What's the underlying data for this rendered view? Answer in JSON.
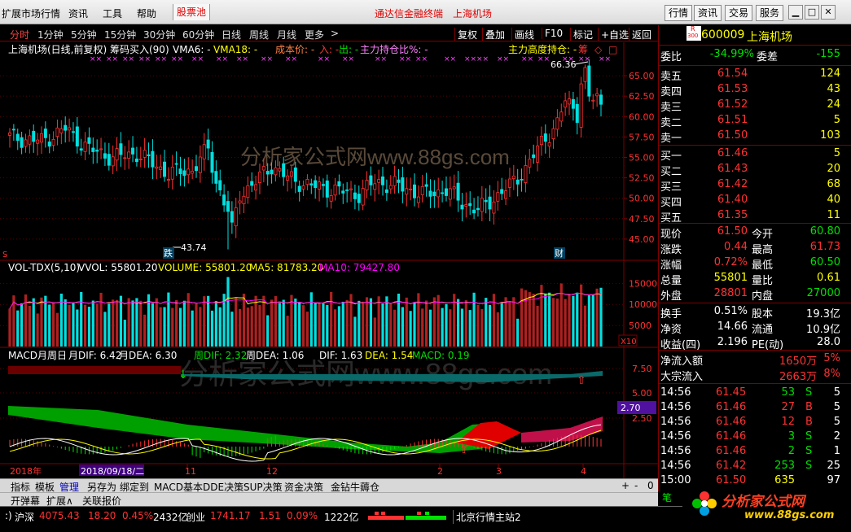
{
  "menubar": {
    "items": [
      "扩展市场行情",
      "资讯",
      "工具",
      "帮助"
    ],
    "stock_pool": "股票池",
    "center_title": "通达信金融终端",
    "center_stock": "上海机场",
    "right_buttons": [
      "行情",
      "资讯",
      "交易",
      "服务"
    ]
  },
  "periods": [
    "分时",
    "1分钟",
    "5分钟",
    "15分钟",
    "30分钟",
    "60分钟",
    "日线",
    "周线",
    "月线",
    "更多",
    ">"
  ],
  "active_period": "分时",
  "tools": [
    "复权",
    "叠加",
    "画线",
    "F10",
    "标记",
    "+自选",
    "返回"
  ],
  "main_chart": {
    "title": "上海机场(日线,前复权) 筹码买入(90)",
    "vma6": "VMA6: -",
    "vma18": "VMA18: -",
    "cost": "成本价: -",
    "in": "入: -",
    "out": "出: -",
    "holding": "主力持仓比%: -",
    "height": "主力高度持仓: -",
    "chou": "筹",
    "high_label": "66.36",
    "low_label": "43.74",
    "die_tag": "跌",
    "cai_tag": "财",
    "watermark": "分析家公式网www.88gs.com",
    "s_marker": "S",
    "y_ticks": [
      "65.00",
      "62.50",
      "60.00",
      "57.50",
      "55.00",
      "52.50",
      "50.00",
      "47.50",
      "45.00"
    ]
  },
  "volume_chart": {
    "title": "VOL-TDX(5,10)",
    "vvol": "VVOL: 55801.20",
    "volume": "VOLUME: 55801.20",
    "ma5": "MA5: 81783.20",
    "ma10": "MA10: 79427.80",
    "y_ticks": [
      "15000",
      "10000",
      "5000"
    ],
    "unit": "X10"
  },
  "macd_chart": {
    "title": "MACD月周日",
    "mdif": "月DIF: 6.42",
    "mdea": "月DEA: 6.30",
    "wdif": "周DIF: 2.32",
    "wdea": "周DEA: 1.06",
    "dif": "DIF: 1.63",
    "dea": "DEA: 1.54",
    "macd": "MACD: 0.19",
    "y_ticks": [
      "7.50",
      "5.00",
      "2.50"
    ],
    "badge": "2.70",
    "watermark": "分析家公式网www.88gs.com"
  },
  "time_axis": {
    "year": "2018年",
    "cursor_date": "2018/09/18/二",
    "months": [
      "11",
      "12",
      "2",
      "3",
      "4"
    ]
  },
  "quote": {
    "code": "600009",
    "name": "上海机场",
    "r_badge": "R",
    "num_badge": "300",
    "wei_bi_label": "委比",
    "wei_bi": "-34.99%",
    "wei_cha_label": "委差",
    "wei_cha": "-155",
    "sells": [
      {
        "label": "卖五",
        "price": "61.54",
        "vol": "124"
      },
      {
        "label": "卖四",
        "price": "61.53",
        "vol": "43"
      },
      {
        "label": "卖三",
        "price": "61.52",
        "vol": "24"
      },
      {
        "label": "卖二",
        "price": "61.51",
        "vol": "5"
      },
      {
        "label": "卖一",
        "price": "61.50",
        "vol": "103"
      }
    ],
    "buys": [
      {
        "label": "买一",
        "price": "61.46",
        "vol": "5"
      },
      {
        "label": "买二",
        "price": "61.43",
        "vol": "20"
      },
      {
        "label": "买三",
        "price": "61.42",
        "vol": "68"
      },
      {
        "label": "买四",
        "price": "61.40",
        "vol": "40"
      },
      {
        "label": "买五",
        "price": "61.35",
        "vol": "11"
      }
    ],
    "stats": [
      {
        "l1": "现价",
        "v1": "61.50",
        "c1": "red",
        "l2": "今开",
        "v2": "60.80",
        "c2": "green"
      },
      {
        "l1": "涨跌",
        "v1": "0.44",
        "c1": "red",
        "l2": "最高",
        "v2": "61.73",
        "c2": "red"
      },
      {
        "l1": "涨幅",
        "v1": "0.72%",
        "c1": "red",
        "l2": "最低",
        "v2": "60.50",
        "c2": "green"
      },
      {
        "l1": "总量",
        "v1": "55801",
        "c1": "yellow",
        "l2": "量比",
        "v2": "0.61",
        "c2": "yellow"
      },
      {
        "l1": "外盘",
        "v1": "28801",
        "c1": "red",
        "l2": "内盘",
        "v2": "27000",
        "c2": "green"
      }
    ],
    "stats2": [
      {
        "l1": "换手",
        "v1": "0.51%",
        "c1": "white",
        "l2": "股本",
        "v2": "19.3亿",
        "c2": "white"
      },
      {
        "l1": "净资",
        "v1": "14.66",
        "c1": "white",
        "l2": "流通",
        "v2": "10.9亿",
        "c2": "white"
      },
      {
        "l1": "收益(四)",
        "v1": "2.196",
        "c1": "white",
        "l2": "PE(动)",
        "v2": "28.0",
        "c2": "white"
      }
    ],
    "flow": [
      {
        "label": "净流入额",
        "value": "1650万",
        "pct": "5%"
      },
      {
        "label": "大宗流入",
        "value": "2663万",
        "pct": "8%"
      }
    ],
    "ticks": [
      {
        "time": "14:56",
        "price": "61.45",
        "vol": "53",
        "bs": "S",
        "n": "5"
      },
      {
        "time": "14:56",
        "price": "61.46",
        "vol": "27",
        "bs": "B",
        "n": "5"
      },
      {
        "time": "14:56",
        "price": "61.46",
        "vol": "12",
        "bs": "B",
        "n": "5"
      },
      {
        "time": "14:56",
        "price": "61.46",
        "vol": "3",
        "bs": "S",
        "n": "2"
      },
      {
        "time": "14:56",
        "price": "61.46",
        "vol": "2",
        "bs": "S",
        "n": "1"
      },
      {
        "time": "14:56",
        "price": "61.42",
        "vol": "253",
        "bs": "S",
        "n": "25"
      },
      {
        "time": "15:00",
        "price": "61.50",
        "vol": "635",
        "bs": "",
        "n": "97"
      }
    ],
    "bi": "笔"
  },
  "bottom_tabs": [
    "指标",
    "模板",
    "管理",
    "另存为",
    "绑定到",
    "MACD基本",
    "DDE决策",
    "SUP决策",
    "资金决策",
    "金钻牛薅仓"
  ],
  "active_tab": "管理",
  "bottom_tabs2": [
    "开弹幕",
    "扩展∧",
    "关联报价"
  ],
  "tab_controls": [
    "+",
    "-",
    "0"
  ],
  "status": {
    "index_name": "沪深",
    "index_val": "4075.43",
    "index_chg": "18.20",
    "index_pct": "0.45%",
    "index_amt": "2432亿",
    "cy_name": "创业",
    "cy_val": "1741.17",
    "cy_chg": "1.51",
    "cy_pct": "0.09%",
    "cy_amt": "1222亿",
    "server": "北京行情主站2"
  },
  "logo": {
    "text": "分析家公式网",
    "url": "www.88gs.com"
  },
  "colors": {
    "up": "#ff3232",
    "down": "#00e0e0",
    "bg": "#000000",
    "grid": "#800000"
  }
}
